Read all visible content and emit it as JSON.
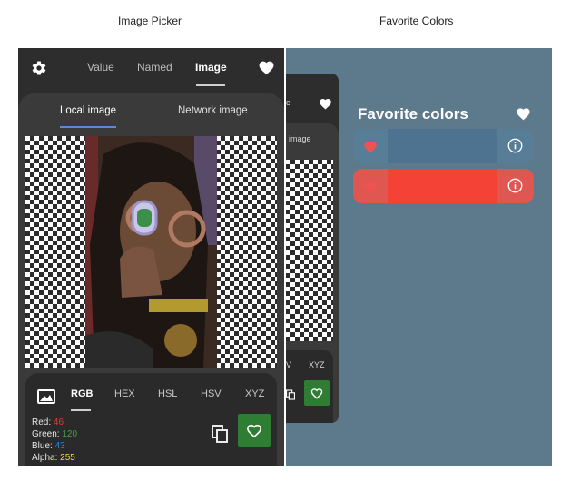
{
  "captions": {
    "left": "Image Picker",
    "right": "Favorite Colors"
  },
  "picker": {
    "top_tabs": [
      "Value",
      "Named",
      "Image"
    ],
    "active_top_tab": "Image",
    "sub_tabs": [
      "Local image",
      "Network image"
    ],
    "active_sub_tab": "Local image",
    "format_tabs": [
      "RGB",
      "HEX",
      "HSL",
      "HSV",
      "XYZ"
    ],
    "active_format_tab": "RGB",
    "values": {
      "red_label": "Red:",
      "red": "46",
      "green_label": "Green:",
      "green": "120",
      "blue_label": "Blue:",
      "blue": "43",
      "alpha_label": "Alpha:",
      "alpha": "255"
    },
    "value_colors": {
      "red": "#e53935",
      "green": "#43a047",
      "blue": "#1e88e5",
      "alpha": "#fdd835"
    },
    "accent_green": "#2e7d32",
    "icons": [
      "gear-icon",
      "heart-icon",
      "image-icon",
      "copy-icon"
    ]
  },
  "favorites": {
    "title": "Favorite colors",
    "background": "#5c7a8c",
    "items": [
      {
        "color": "#4e7390",
        "row_bg": "#587d96"
      },
      {
        "color": "#f44336",
        "row_bg": "#e05752"
      }
    ],
    "mini": {
      "tab_fragment": "e",
      "sub_tab_fragment": "image",
      "format_fragment_1": "V",
      "format_fragment_2": "XYZ"
    }
  }
}
